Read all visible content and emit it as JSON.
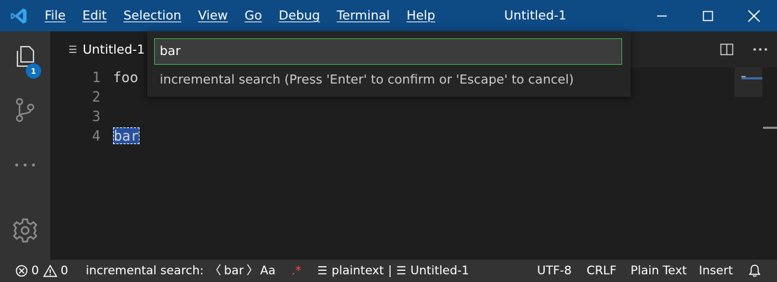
{
  "window": {
    "title": "Untitled-1",
    "menu": [
      "File",
      "Edit",
      "Selection",
      "View",
      "Go",
      "Debug",
      "Terminal",
      "Help"
    ]
  },
  "activity": {
    "explorer_badge": "1"
  },
  "tabs": [
    {
      "label": "Untitled-1",
      "icon": "text-file-icon"
    }
  ],
  "editor": {
    "lines": [
      {
        "number": "1",
        "text": "foo"
      },
      {
        "number": "2",
        "text": ""
      },
      {
        "number": "3",
        "text": ""
      },
      {
        "number": "4",
        "text": "bar"
      }
    ],
    "selected_text": "bar"
  },
  "quick_input": {
    "value": "bar",
    "message": "incremental search (Press 'Enter' to confirm or 'Escape' to cancel)"
  },
  "status": {
    "errors": "0",
    "warnings": "0",
    "search_label": "incremental search:",
    "search_prev": "〈",
    "search_term": "bar",
    "search_next": "〉",
    "case_toggle": "Aa",
    "regex_toggle": ".*",
    "plaintext_item": "plaintext",
    "separator": "|",
    "file_item": "Untitled-1",
    "encoding": "UTF-8",
    "eol": "CRLF",
    "language": "Plain Text",
    "mode": "Insert"
  },
  "colors": {
    "titlebar": "#0e4a84",
    "accent": "#0e70c0",
    "input_border": "#3bb14a"
  }
}
